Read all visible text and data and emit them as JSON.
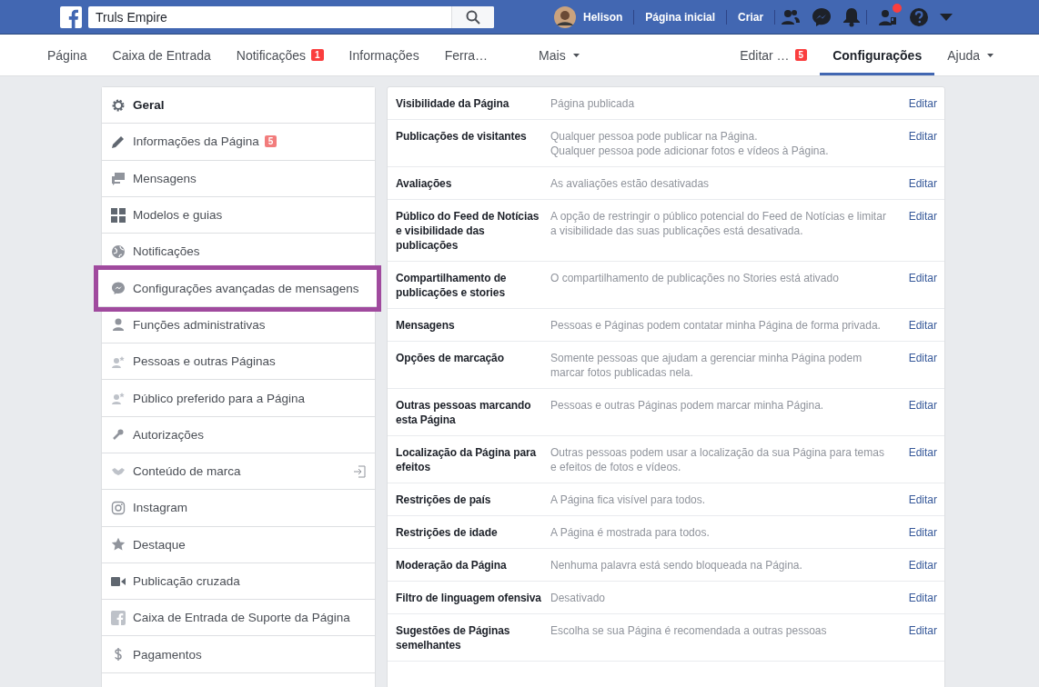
{
  "top_bar": {
    "search": {
      "value": "Truls Empire"
    },
    "user": "Helison",
    "links": [
      "Página inicial",
      "Criar"
    ],
    "notification_dot": true
  },
  "page_nav": {
    "items": [
      {
        "label": "Página",
        "selected": false,
        "dropdown": false
      },
      {
        "label": "Caixa de Entrada",
        "selected": false,
        "dropdown": false
      },
      {
        "label": "Notificações",
        "badge": "1",
        "selected": false,
        "dropdown": false
      },
      {
        "label": "Informações",
        "selected": false,
        "dropdown": false
      },
      {
        "label": "Ferra…",
        "selected": false,
        "dropdown": false
      },
      {
        "label": "Mais",
        "selected": false,
        "dropdown": true
      }
    ],
    "right_items": [
      {
        "label": "Editar …",
        "badge": "5",
        "selected": false,
        "dropdown": false
      },
      {
        "label": "Configurações",
        "selected": true,
        "dropdown": false
      },
      {
        "label": "Ajuda",
        "selected": false,
        "dropdown": true
      }
    ]
  },
  "sidebar": {
    "items": [
      {
        "label": "Geral",
        "selected": true,
        "highlighted": false
      },
      {
        "label": "Informações da Página",
        "badge": "5",
        "selected": false,
        "highlighted": false
      },
      {
        "label": "Mensagens",
        "selected": false,
        "highlighted": false
      },
      {
        "label": "Modelos e guias",
        "selected": false,
        "highlighted": false
      },
      {
        "label": "Notificações",
        "selected": false,
        "highlighted": false
      },
      {
        "label": "Configurações avançadas de mensagens",
        "selected": false,
        "highlighted": true
      },
      {
        "label": "Funções administrativas",
        "selected": false,
        "highlighted": false
      },
      {
        "label": "Pessoas e outras Páginas",
        "selected": false,
        "highlighted": false
      },
      {
        "label": "Público preferido para a Página",
        "selected": false,
        "highlighted": false
      },
      {
        "label": "Autorizações",
        "selected": false,
        "highlighted": false
      },
      {
        "label": "Conteúdo de marca",
        "selected": false,
        "highlighted": false,
        "external": true
      },
      {
        "label": "Instagram",
        "selected": false,
        "highlighted": false
      },
      {
        "label": "Destaque",
        "selected": false,
        "highlighted": false
      },
      {
        "label": "Publicação cruzada",
        "selected": false,
        "highlighted": false
      },
      {
        "label": "Caixa de Entrada de Suporte da Página",
        "selected": false,
        "highlighted": false
      },
      {
        "label": "Pagamentos",
        "selected": false,
        "highlighted": false
      }
    ]
  },
  "settings": {
    "rows": [
      {
        "name": "Visibilidade da Página",
        "value": [
          "Página publicada"
        ],
        "action": "Editar"
      },
      {
        "name": "Publicações de visitantes",
        "value": [
          "Qualquer pessoa pode publicar na Página.",
          "Qualquer pessoa pode adicionar fotos e vídeos à Página."
        ],
        "action": "Editar"
      },
      {
        "name": "Avaliações",
        "value": [
          "As avaliações estão desativadas"
        ],
        "action": "Editar"
      },
      {
        "name": "Público do Feed de Notícias e visibilidade das publicações",
        "value": [
          "A opção de restringir o público potencial do Feed de Notícias e limitar a visibilidade das suas publicações está desativada."
        ],
        "action": "Editar"
      },
      {
        "name": "Compartilhamento de publicações e stories",
        "value": [
          "O compartilhamento de publicações no Stories está ativado"
        ],
        "action": "Editar"
      },
      {
        "name": "Mensagens",
        "value": [
          "Pessoas e Páginas podem contatar minha Página de forma privada."
        ],
        "action": "Editar"
      },
      {
        "name": "Opções de marcação",
        "value": [
          "Somente pessoas que ajudam a gerenciar minha Página podem marcar fotos publicadas nela."
        ],
        "action": "Editar"
      },
      {
        "name": "Outras pessoas marcando esta Página",
        "value": [
          "Pessoas e outras Páginas podem marcar minha Página."
        ],
        "action": "Editar"
      },
      {
        "name": "Localização da Página para efeitos",
        "value": [
          "Outras pessoas podem usar a localização da sua Página para temas e efeitos de fotos e vídeos."
        ],
        "action": "Editar"
      },
      {
        "name": "Restrições de país",
        "value": [
          "A Página fica visível para todos."
        ],
        "action": "Editar"
      },
      {
        "name": "Restrições de idade",
        "value": [
          "A Página é mostrada para todos."
        ],
        "action": "Editar"
      },
      {
        "name": "Moderação da Página",
        "value": [
          "Nenhuma palavra está sendo bloqueada na Página."
        ],
        "action": "Editar"
      },
      {
        "name": "Filtro de linguagem ofensiva",
        "value": [
          "Desativado"
        ],
        "action": "Editar"
      },
      {
        "name": "Sugestões de Páginas semelhantes",
        "value": [
          "Escolha se sua Página é recomendada a outras pessoas"
        ],
        "action": "Editar"
      }
    ]
  }
}
